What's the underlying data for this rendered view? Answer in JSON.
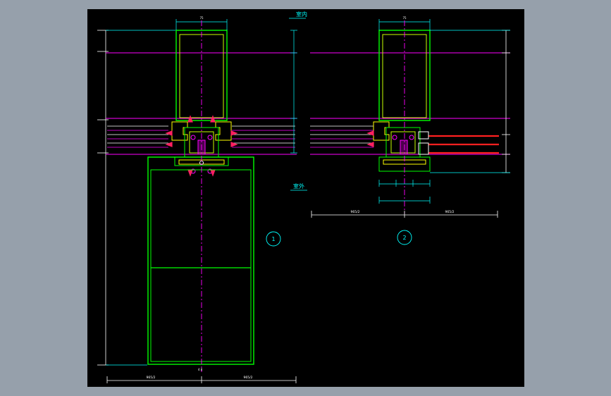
{
  "drawing": {
    "label_interior": "室内",
    "label_exterior": "室外",
    "section_marks": [
      "1",
      "2"
    ],
    "dim_half_width": "965/2",
    "dim_top_small": "75",
    "dim_bottom_small": "4 8"
  },
  "colors": {
    "background": "#96a0ab",
    "canvas": "#000000",
    "frame_green": "#00ff00",
    "center_magenta": "#ff00ff",
    "dim_cyan": "#00ffff",
    "profile_yellow": "#ffff00",
    "glass_red": "#ff2020",
    "accent_lime": "#c8ff00",
    "dim_white": "#ffffff"
  }
}
